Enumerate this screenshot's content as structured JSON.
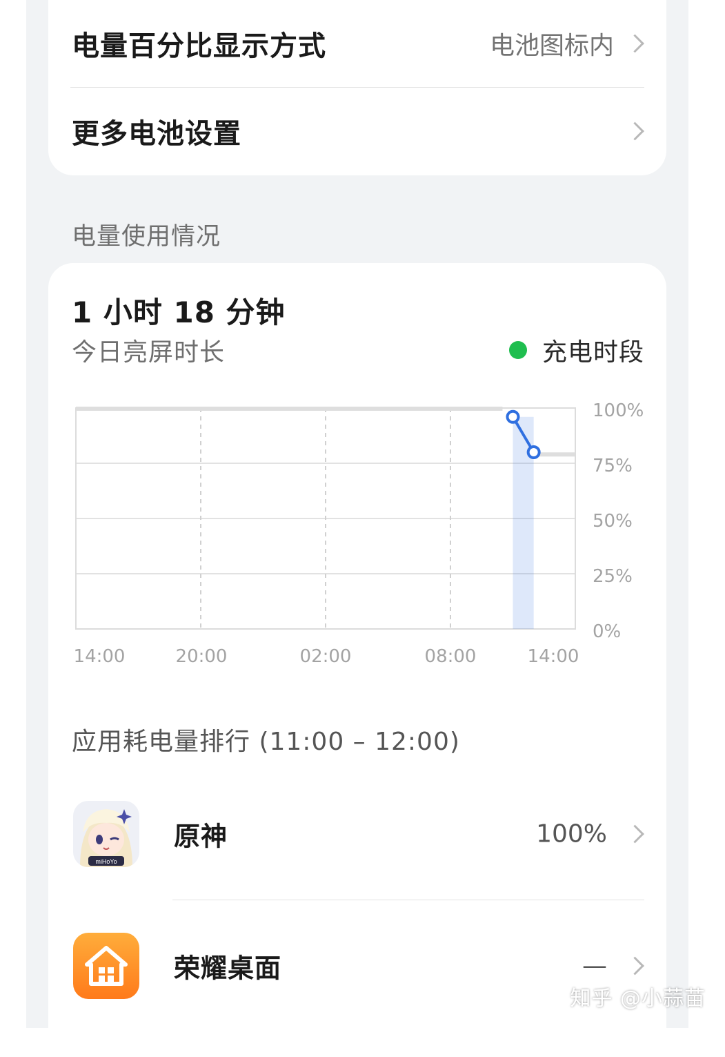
{
  "settings": {
    "items": [
      {
        "label": "电量百分比显示方式",
        "value": "电池图标内"
      },
      {
        "label": "更多电池设置",
        "value": ""
      }
    ]
  },
  "usage_section": {
    "title": "电量使用情况",
    "screen_time": "1 小时 18 分钟",
    "screen_time_label": "今日亮屏时长",
    "legend_label": "充电时段",
    "legend_color": "#1fbe4f",
    "line_color": "#2f6fe0"
  },
  "chart_data": {
    "type": "line",
    "x_ticks": [
      "14:00",
      "20:00",
      "02:00",
      "08:00",
      "14:00"
    ],
    "y_ticks": [
      "100%",
      "75%",
      "50%",
      "25%",
      "0%"
    ],
    "ylim": [
      0,
      100
    ],
    "x_hours_range": [
      0,
      24
    ],
    "grid": true,
    "series": [
      {
        "points": [
          {
            "x_hours": 21,
            "y": 96
          },
          {
            "x_hours": 22,
            "y": 80
          }
        ]
      }
    ],
    "baseline_before": {
      "from_hours": 0,
      "to_hours": 20.5,
      "y": 100
    },
    "baseline_after": {
      "from_hours": 22,
      "to_hours": 24,
      "y": 79
    },
    "highlight_band": {
      "from_hours": 21,
      "to_hours": 22
    }
  },
  "ranking": {
    "title": "应用耗电量排行 (11:00 – 12:00)",
    "apps": [
      {
        "name": "原神",
        "value": "100%",
        "icon": "genshin-app-icon"
      },
      {
        "name": "荣耀桌面",
        "value": "—",
        "icon": "honor-home-app-icon"
      }
    ]
  },
  "watermark": "知乎 @小蒜苗"
}
